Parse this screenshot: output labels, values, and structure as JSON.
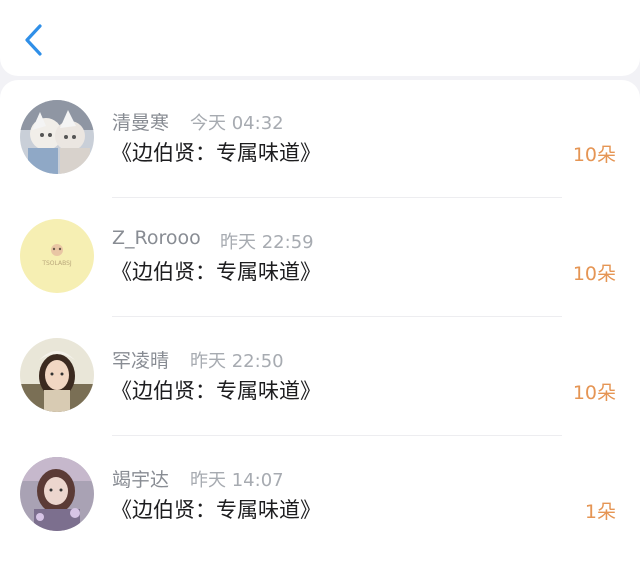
{
  "header": {
    "back_icon": "chevron-left-icon",
    "accent_color": "#2f8fe8"
  },
  "records": [
    {
      "name": "清曼寒",
      "time": "今天 04:32",
      "gift": "《边伯贤：专属味道》",
      "count": "10朵"
    },
    {
      "name": "Z_Rorooo",
      "time": "昨天 22:59",
      "gift": "《边伯贤：专属味道》",
      "count": "10朵",
      "avatar_text": "TSOLABSJ"
    },
    {
      "name": "罕凌晴",
      "time": "昨天 22:50",
      "gift": "《边伯贤：专属味道》",
      "count": "10朵"
    },
    {
      "name": "竭宇达",
      "time": "昨天 14:07",
      "gift": "《边伯贤：专属味道》",
      "count": "1朵"
    }
  ],
  "colors": {
    "count": "#e59554",
    "name": "#888c93",
    "time": "#a7abb1"
  }
}
